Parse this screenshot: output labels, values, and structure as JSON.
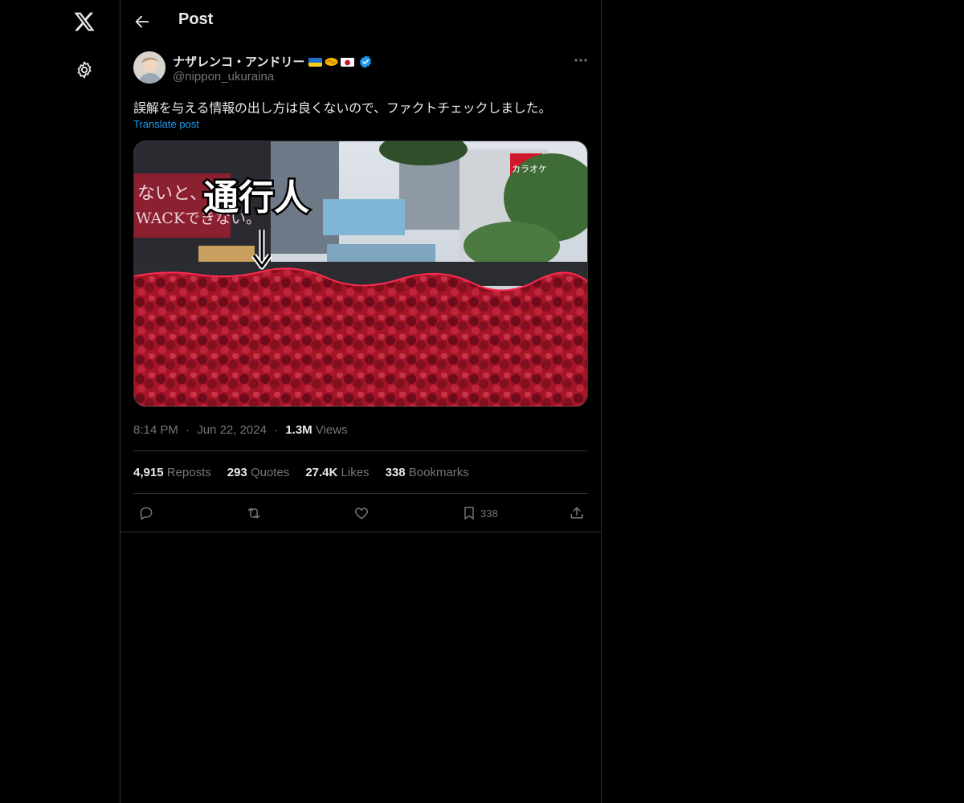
{
  "nav": {
    "logo_icon": "x-logo-icon",
    "settings_icon": "gear-icon"
  },
  "header": {
    "title": "Post",
    "back_icon": "arrow-left-icon"
  },
  "post": {
    "author": {
      "display_name": "ナザレンコ・アンドリー",
      "handle": "@nippon_ukuraina",
      "verified": true,
      "name_emojis": [
        "ukraine-flag",
        "handshake",
        "japan-flag"
      ]
    },
    "text": "誤解を与える情報の出し方は良くないので、ファクトチェックしました。",
    "translate_label": "Translate post",
    "media": {
      "overlay_text": "通行人",
      "banner_left": "ないと、",
      "banner_left_2": "WACKできない。",
      "sign_right": "カラオケ"
    },
    "time": "8:14 PM",
    "date": "Jun 22, 2024",
    "views_count": "1.3M",
    "views_label": "Views",
    "separator": "·"
  },
  "stats": {
    "reposts_count": "4,915",
    "reposts_label": "Reposts",
    "quotes_count": "293",
    "quotes_label": "Quotes",
    "likes_count": "27.4K",
    "likes_label": "Likes",
    "bookmarks_count": "338",
    "bookmarks_label": "Bookmarks"
  },
  "actions": {
    "reply_icon": "reply-icon",
    "repost_icon": "repost-icon",
    "like_icon": "heart-icon",
    "bookmark_icon": "bookmark-icon",
    "bookmark_count": "338",
    "share_icon": "share-icon"
  },
  "colors": {
    "background": "#000000",
    "text": "#e7e9ea",
    "muted": "#71767b",
    "link": "#1d9bf0",
    "border": "#2f3336",
    "verified": "#1d9bf0"
  }
}
